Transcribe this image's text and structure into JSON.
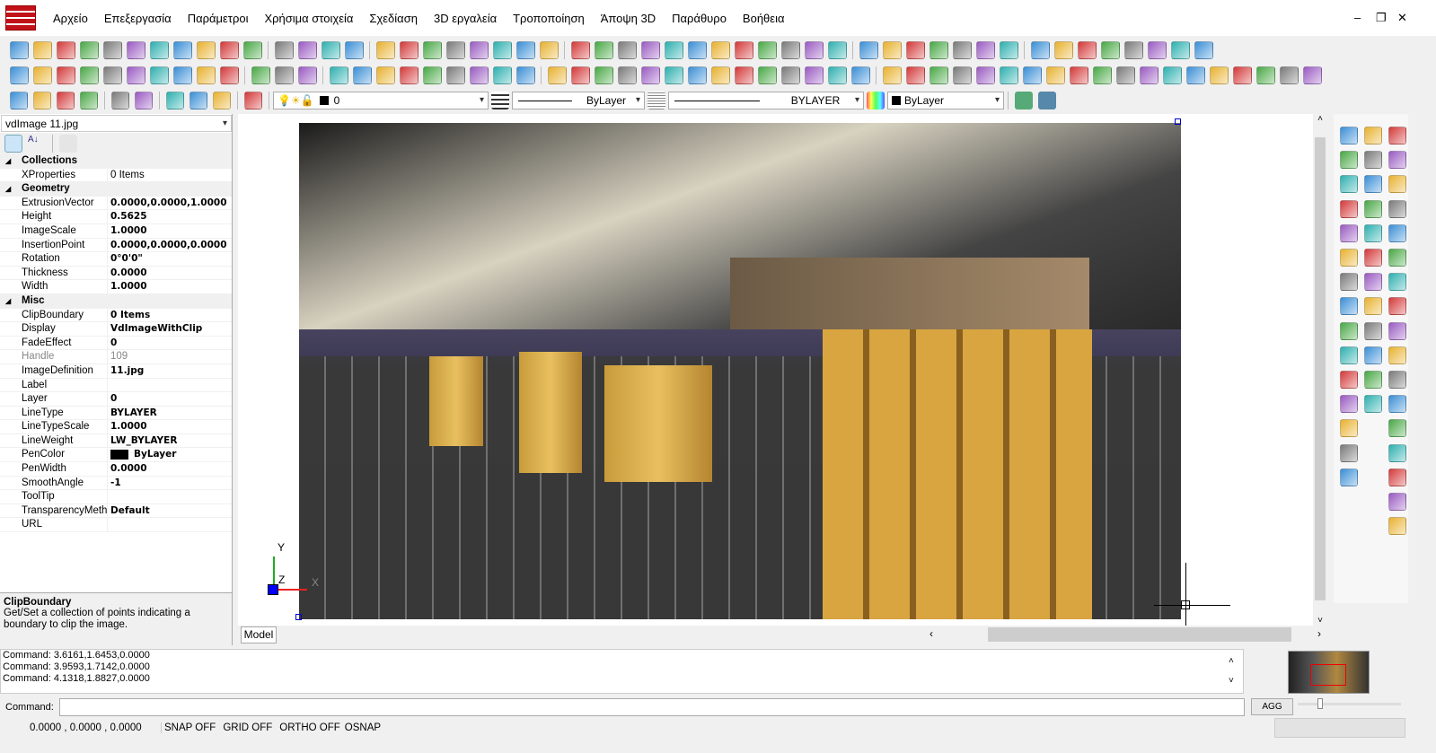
{
  "menu": [
    "Αρχείο",
    "Επεξεργασία",
    "Παράμετροι",
    "Χρήσιμα στοιχεία",
    "Σχεδίαση",
    "3D εργαλεία",
    "Τροποποίηση",
    "Άποψη 3D",
    "Παράθυρο",
    "Βοήθεια"
  ],
  "window_buttons": [
    "–",
    "❐",
    "✕"
  ],
  "toolbar1_icons": [
    "new",
    "open",
    "template",
    "save",
    "print",
    "print-preview",
    "export-image",
    "pdf",
    "export",
    "layers",
    "properties",
    "regen",
    "regen-all",
    "undo",
    "redo",
    "render",
    "orbit",
    "shade",
    "wireframe",
    "hidden",
    "flat",
    "axis",
    "globe",
    "snap-end",
    "snap-center",
    "snap-mid",
    "snap-near",
    "snap-perp",
    "snap-ins",
    "snap-quad",
    "snap-node",
    "snap-tan",
    "snap-int",
    "snap-par",
    "snap-off",
    "magnet",
    "layer-mgr",
    "text-style",
    "dim",
    "xref",
    "attach",
    "block",
    "hyperlink",
    "light",
    "pen",
    "sun",
    "ucs",
    "ruler",
    "view",
    "frame"
  ],
  "toolbar2_icons": [
    "view-top",
    "view-bottom",
    "view-left",
    "view-right",
    "view-front",
    "view-back",
    "iso-sw",
    "iso-se",
    "iso-ne",
    "iso-nw",
    "copy",
    "cut",
    "paste",
    "zoom",
    "zoom-extents",
    "zoom-window",
    "zoom-previous",
    "zoom-in",
    "zoom-out",
    "pan",
    "zoom-scale",
    "zoom-dynamic",
    "edit",
    "brush",
    "arc",
    "dim",
    "cylinder",
    "box",
    "surface",
    "solid",
    "torus",
    "ring",
    "donut",
    "sphere",
    "landscape",
    "grip",
    "grip2",
    "add",
    "delete",
    "move",
    "rotate",
    "scale",
    "mirror",
    "array",
    "offset",
    "trim",
    "extend",
    "break",
    "fillet",
    "chamfer",
    "hatch",
    "wedge",
    "text",
    "image",
    "cloud"
  ],
  "toolbar3_icons": [
    "binoculars",
    "hatch",
    "raster",
    "palette",
    "window-cascade",
    "window-tile",
    "measure",
    "zoom-target",
    "chart",
    "brush"
  ],
  "layer_combo": {
    "value": "0"
  },
  "lineweight_combo": {
    "value": "ByLayer"
  },
  "linetype_combo": {
    "value": "BYLAYER"
  },
  "color_combo": {
    "value": "ByLayer"
  },
  "props": {
    "selector": "vdImage 11.jpg",
    "categories": [
      {
        "name": "Collections",
        "rows": [
          {
            "k": "XProperties",
            "v": "0 Items",
            "bold": false
          }
        ]
      },
      {
        "name": "Geometry",
        "rows": [
          {
            "k": "ExtrusionVector",
            "v": "0.0000,0.0000,1.0000",
            "bold": true
          },
          {
            "k": "Height",
            "v": "0.5625",
            "bold": true
          },
          {
            "k": "ImageScale",
            "v": "1.0000",
            "bold": true
          },
          {
            "k": "InsertionPoint",
            "v": "0.0000,0.0000,0.0000",
            "bold": true
          },
          {
            "k": "Rotation",
            "v": "0°0'0\"",
            "bold": true
          },
          {
            "k": "Thickness",
            "v": "0.0000",
            "bold": true
          },
          {
            "k": "Width",
            "v": "1.0000",
            "bold": true
          }
        ]
      },
      {
        "name": "Misc",
        "rows": [
          {
            "k": "ClipBoundary",
            "v": "0 Items",
            "bold": true
          },
          {
            "k": "Display",
            "v": "VdImageWithClip",
            "bold": true
          },
          {
            "k": "FadeEffect",
            "v": "0",
            "bold": true
          },
          {
            "k": "Handle",
            "v": "109",
            "bold": false,
            "disabled": true
          },
          {
            "k": "ImageDefinition",
            "v": "11.jpg",
            "bold": true
          },
          {
            "k": "Label",
            "v": "",
            "bold": true
          },
          {
            "k": "Layer",
            "v": "0",
            "bold": true
          },
          {
            "k": "LineType",
            "v": "BYLAYER",
            "bold": true
          },
          {
            "k": "LineTypeScale",
            "v": "1.0000",
            "bold": true
          },
          {
            "k": "LineWeight",
            "v": "LW_BYLAYER",
            "bold": true
          },
          {
            "k": "PenColor",
            "v": "ByLayer",
            "bold": true,
            "swatch": "#000000"
          },
          {
            "k": "PenWidth",
            "v": "0.0000",
            "bold": true
          },
          {
            "k": "SmoothAngle",
            "v": "-1",
            "bold": true
          },
          {
            "k": "ToolTip",
            "v": "",
            "bold": true
          },
          {
            "k": "TransparencyMetho",
            "v": "Default",
            "bold": true
          },
          {
            "k": "URL",
            "v": "",
            "bold": true
          }
        ]
      }
    ],
    "desc_title": "ClipBoundary",
    "desc_text": "Get/Set a collection of points indicating a boundary to clip the image."
  },
  "viewport": {
    "model_tab": "Model",
    "ucs_y": "Y",
    "ucs_x": "X",
    "ucs_z": "Z"
  },
  "right_icons": [
    "line",
    "circle",
    "layer-a",
    "arc",
    "circle-2p",
    "layer-b",
    "text",
    "circle-3p",
    "layer-c",
    "mtext",
    "circle-ttr",
    "tag",
    "dim-text",
    "ellipse",
    "layer-d",
    "point",
    "polygon",
    "layer-e",
    "spline",
    "box3d",
    "dim-vert",
    "rectangle",
    "cone",
    "dim-horiz",
    "cloud",
    "sphere",
    "dim-aligned",
    "image",
    "torus",
    "dim-radius",
    "xline",
    "pyramid",
    "dim-scale",
    "ray",
    "wedge",
    "dim-rotate",
    "wave",
    "",
    "dim-angle",
    "multiline",
    "",
    "dim-arc",
    "leader",
    "",
    "dim-ordinate",
    "",
    "",
    "grid",
    "",
    "",
    "gear"
  ],
  "command": {
    "history": [
      "Command: 3.6161,1.6453,0.0000",
      "Command: 3.9593,1.7142,0.0000",
      "Command: 4.1318,1.8827,0.0000"
    ],
    "label": "Command:",
    "value": "",
    "agg": "AGG"
  },
  "status": {
    "coords": "0.0000 , 0.0000 , 0.0000",
    "snap": "SNAP OFF",
    "grid": "GRID OFF",
    "ortho": "ORTHO OFF",
    "osnap": "OSNAP"
  },
  "colors": {
    "accent_red": "#c1121a",
    "selection": "#cce4f7"
  }
}
